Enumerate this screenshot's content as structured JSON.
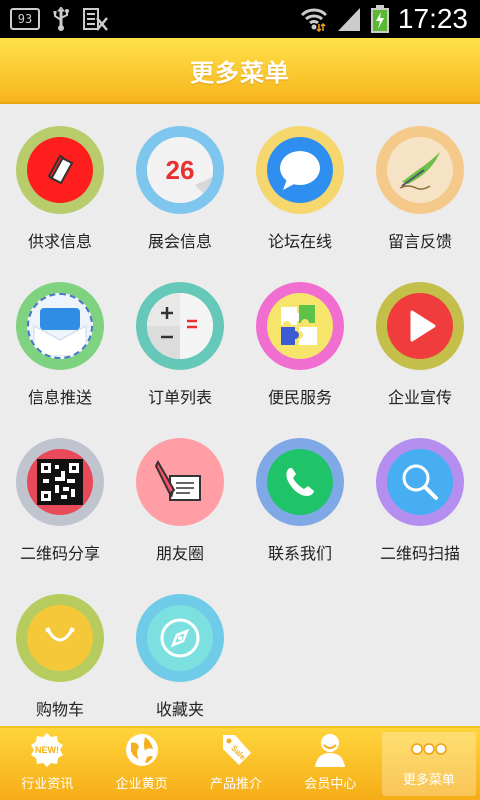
{
  "status_bar": {
    "notification_badge": "93",
    "time": "17:23"
  },
  "header": {
    "title": "更多菜单"
  },
  "menu_items": [
    {
      "label": "供求信息",
      "icon": "book-icon",
      "ring_color": "#b9cc6b",
      "inner_color": "#ff1e1e"
    },
    {
      "label": "展会信息",
      "icon": "calendar-icon",
      "ring_color": "#7fc6ef",
      "inner_color": "#f0f0f0",
      "calendar_day": "26"
    },
    {
      "label": "论坛在线",
      "icon": "chat-bubble-icon",
      "ring_color": "#f5d76e",
      "inner_color": "#2e8ff0"
    },
    {
      "label": "留言反馈",
      "icon": "quill-pen-icon",
      "ring_color": "#f5c98a",
      "inner_color": "#f6e2c4"
    },
    {
      "label": "信息推送",
      "icon": "envelope-icon",
      "ring_color": "#7fd27f",
      "inner_color": "#eef4fb"
    },
    {
      "label": "订单列表",
      "icon": "calculator-icon",
      "ring_color": "#66c8b8",
      "inner_color": "#f5f5f5"
    },
    {
      "label": "便民服务",
      "icon": "puzzle-icon",
      "ring_color": "#f06ecf",
      "inner_color": "#f7e46a"
    },
    {
      "label": "企业宣传",
      "icon": "play-icon",
      "ring_color": "#c3bf4a",
      "inner_color": "#f03c3c"
    },
    {
      "label": "二维码分享",
      "icon": "qr-code-icon",
      "ring_color": "#c0c4cf",
      "inner_color": "#e84a5a"
    },
    {
      "label": "朋友圈",
      "icon": "pen-paper-icon",
      "ring_color": "#ff9fa5",
      "inner_color": "#ff9fa5"
    },
    {
      "label": "联系我们",
      "icon": "phone-icon",
      "ring_color": "#80a8e6",
      "inner_color": "#1fc46a"
    },
    {
      "label": "二维码扫描",
      "icon": "magnifier-icon",
      "ring_color": "#b48ff0",
      "inner_color": "#48aef2"
    },
    {
      "label": "购物车",
      "icon": "shopping-bag-icon",
      "ring_color": "#b6cc5e",
      "inner_color": "#f5c83a"
    },
    {
      "label": "收藏夹",
      "icon": "compass-icon",
      "ring_color": "#6fcbe8",
      "inner_color": "#7de0e0"
    }
  ],
  "tabs": [
    {
      "label": "行业资讯",
      "icon": "new-badge-icon"
    },
    {
      "label": "企业黄页",
      "icon": "globe-icon"
    },
    {
      "label": "产品推介",
      "icon": "sale-tag-icon"
    },
    {
      "label": "会员中心",
      "icon": "user-icon"
    },
    {
      "label": "更多菜单",
      "icon": "more-dots-icon",
      "active": true
    }
  ]
}
